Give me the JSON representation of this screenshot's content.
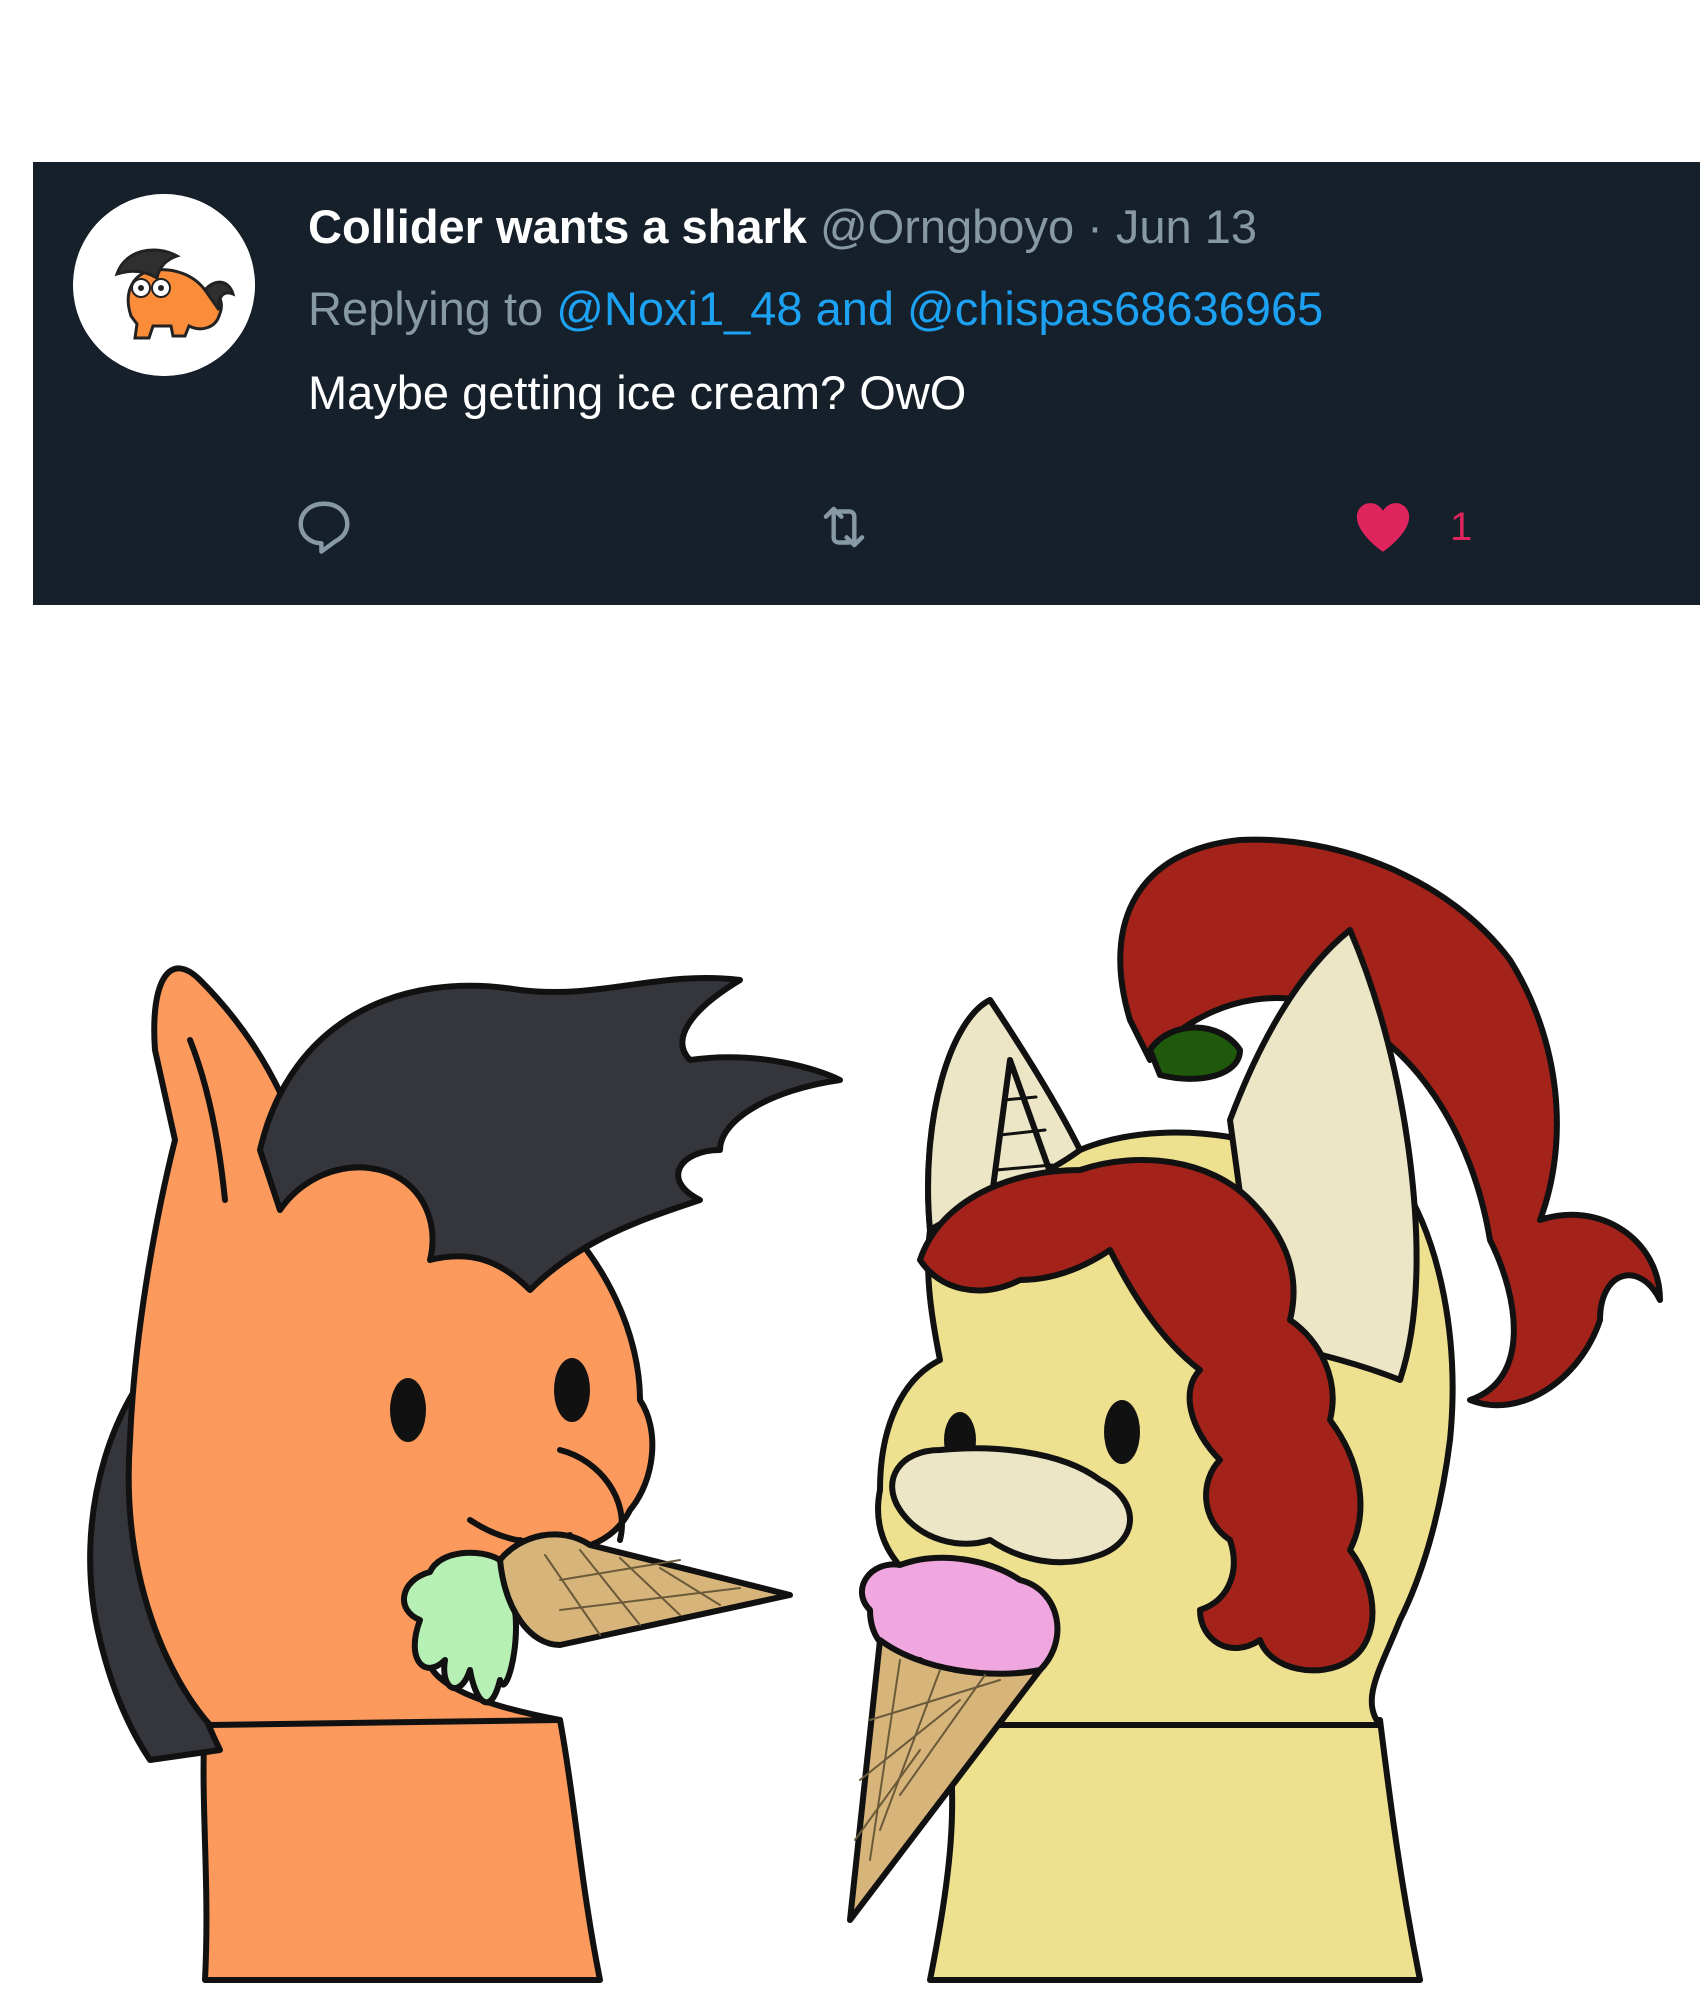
{
  "tweet": {
    "display_name": "Collider wants a shark",
    "handle": "@Orngboyo",
    "separator": "·",
    "date": "Jun 13",
    "replying_prefix": "Replying to",
    "reply_mention_1": "@Noxi1_48",
    "reply_joiner": "and",
    "reply_mention_2": "@chispas68636965",
    "text": "Maybe getting ice cream? OwO",
    "like_count": "1"
  },
  "icons": {
    "reply": "reply-icon",
    "retweet": "retweet-icon",
    "like": "heart-icon"
  },
  "colors": {
    "card_background": "#15202b",
    "name": "#ffffff",
    "muted": "#8899a6",
    "mention": "#1da1f2",
    "like": "#e0245e",
    "orange_pony": "#fb9a5c",
    "orange_pony_mane": "#34363c",
    "cream_pony": "#ede08f",
    "cream_pony_mane": "#a3231a",
    "green_ice_cream": "#b7f0b4",
    "pink_ice_cream": "#f0a6de",
    "cone": "#d7b47a"
  }
}
